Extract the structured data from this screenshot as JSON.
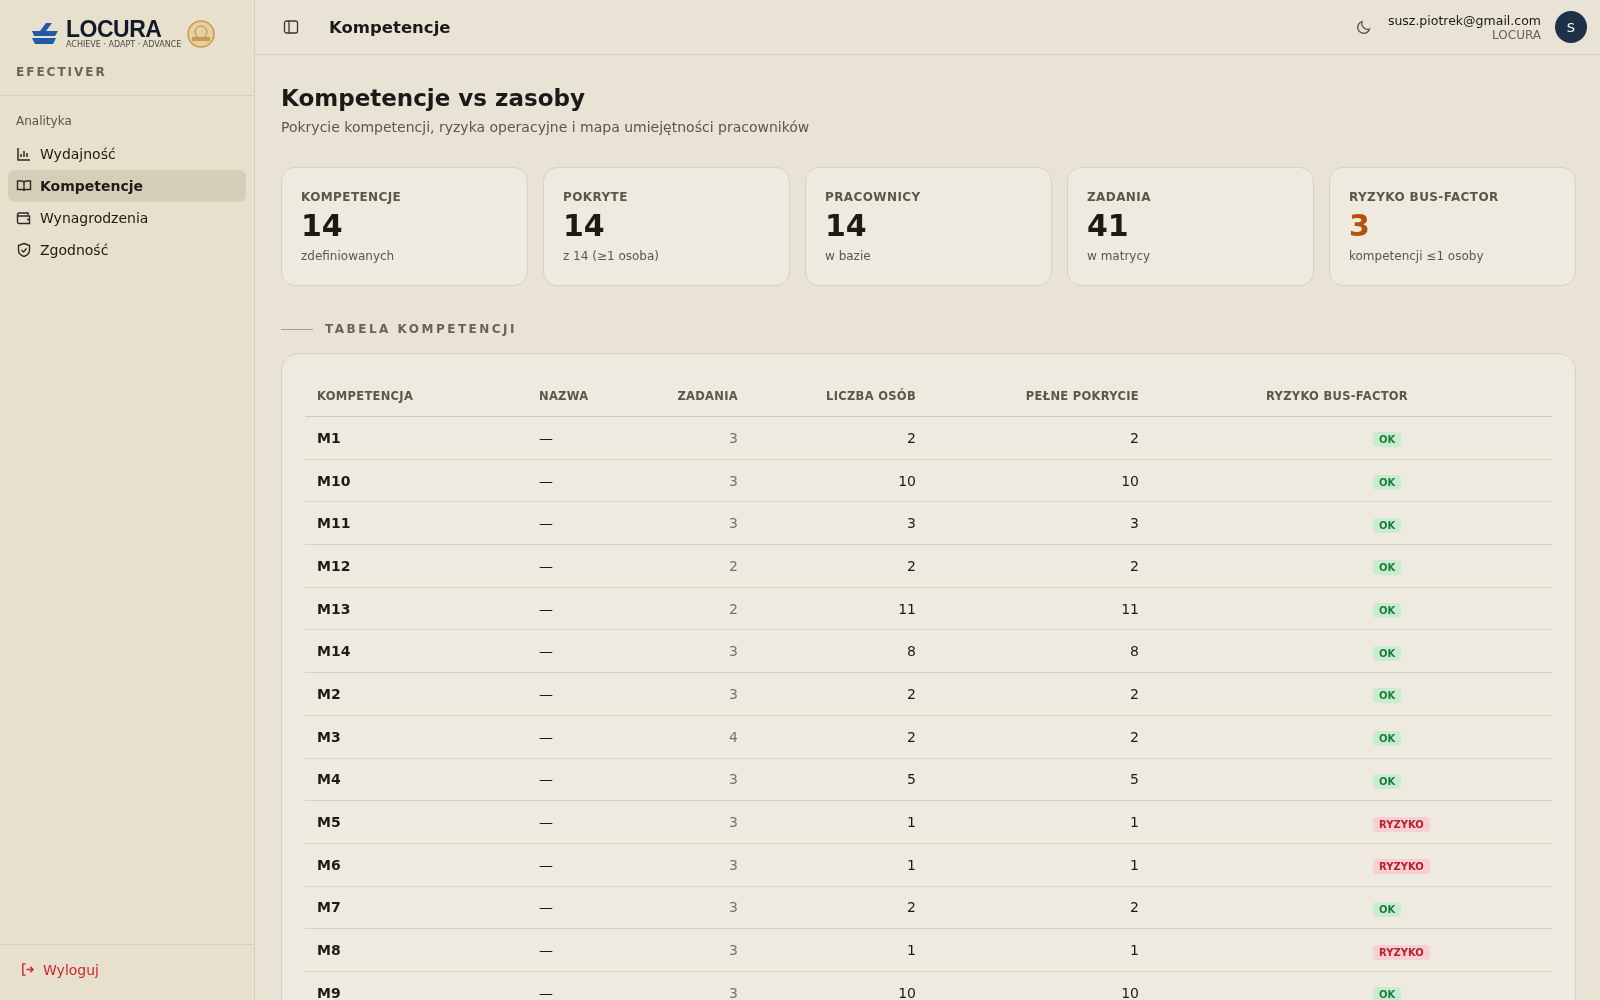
{
  "sidebar": {
    "logo": {
      "name": "LOCURA",
      "tagline": "ACHIEVE · ADAPT · ADVANCE"
    },
    "app_name": "EFECTIVER",
    "section": "Analityka",
    "items": [
      {
        "label": "Wydajność",
        "selected": false
      },
      {
        "label": "Kompetencje",
        "selected": true
      },
      {
        "label": "Wynagrodzenia",
        "selected": false
      },
      {
        "label": "Zgodność",
        "selected": false
      }
    ],
    "logout": "Wyloguj"
  },
  "topbar": {
    "title": "Kompetencje",
    "user": {
      "email": "susz.piotrek@gmail.com",
      "org": "LOCURA",
      "initial": "S"
    }
  },
  "page": {
    "title": "Kompetencje vs zasoby",
    "subtitle": "Pokrycie kompetencji, ryzyka operacyjne i mapa umiejętności pracowników"
  },
  "stats": [
    {
      "label": "KOMPETENCJE",
      "value": "14",
      "note": "zdefiniowanych",
      "highlight": false
    },
    {
      "label": "POKRYTE",
      "value": "14",
      "note": "z 14 (≥1 osoba)",
      "highlight": false
    },
    {
      "label": "PRACOWNICY",
      "value": "14",
      "note": "w bazie",
      "highlight": false
    },
    {
      "label": "ZADANIA",
      "value": "41",
      "note": "w matrycy",
      "highlight": false
    },
    {
      "label": "RYZYKO BUS-FACTOR",
      "value": "3",
      "note": "kompetencji ≤1 osoby",
      "highlight": true
    }
  ],
  "section_title": "TABELA KOMPETENCJI",
  "table": {
    "columns": [
      "KOMPETENCJA",
      "NAZWA",
      "ZADANIA",
      "LICZBA OSÓB",
      "PEŁNE POKRYCIE",
      "RYZYKO BUS-FACTOR"
    ],
    "rows": [
      {
        "code": "M1",
        "name": "—",
        "tasks": "3",
        "people": "2",
        "full": "2",
        "risk": {
          "label": "OK",
          "kind": "ok"
        }
      },
      {
        "code": "M10",
        "name": "—",
        "tasks": "3",
        "people": "10",
        "full": "10",
        "risk": {
          "label": "OK",
          "kind": "ok"
        }
      },
      {
        "code": "M11",
        "name": "—",
        "tasks": "3",
        "people": "3",
        "full": "3",
        "risk": {
          "label": "OK",
          "kind": "ok"
        }
      },
      {
        "code": "M12",
        "name": "—",
        "tasks": "2",
        "people": "2",
        "full": "2",
        "risk": {
          "label": "OK",
          "kind": "ok"
        }
      },
      {
        "code": "M13",
        "name": "—",
        "tasks": "2",
        "people": "11",
        "full": "11",
        "risk": {
          "label": "OK",
          "kind": "ok"
        }
      },
      {
        "code": "M14",
        "name": "—",
        "tasks": "3",
        "people": "8",
        "full": "8",
        "risk": {
          "label": "OK",
          "kind": "ok"
        }
      },
      {
        "code": "M2",
        "name": "—",
        "tasks": "3",
        "people": "2",
        "full": "2",
        "risk": {
          "label": "OK",
          "kind": "ok"
        }
      },
      {
        "code": "M3",
        "name": "—",
        "tasks": "4",
        "people": "2",
        "full": "2",
        "risk": {
          "label": "OK",
          "kind": "ok"
        }
      },
      {
        "code": "M4",
        "name": "—",
        "tasks": "3",
        "people": "5",
        "full": "5",
        "risk": {
          "label": "OK",
          "kind": "ok"
        }
      },
      {
        "code": "M5",
        "name": "—",
        "tasks": "3",
        "people": "1",
        "full": "1",
        "risk": {
          "label": "RYZYKO",
          "kind": "risk"
        }
      },
      {
        "code": "M6",
        "name": "—",
        "tasks": "3",
        "people": "1",
        "full": "1",
        "risk": {
          "label": "RYZYKO",
          "kind": "risk"
        }
      },
      {
        "code": "M7",
        "name": "—",
        "tasks": "3",
        "people": "2",
        "full": "2",
        "risk": {
          "label": "OK",
          "kind": "ok"
        }
      },
      {
        "code": "M8",
        "name": "—",
        "tasks": "3",
        "people": "1",
        "full": "1",
        "risk": {
          "label": "RYZYKO",
          "kind": "risk"
        }
      },
      {
        "code": "M9",
        "name": "—",
        "tasks": "3",
        "people": "10",
        "full": "10",
        "risk": {
          "label": "OK",
          "kind": "ok"
        }
      }
    ]
  }
}
